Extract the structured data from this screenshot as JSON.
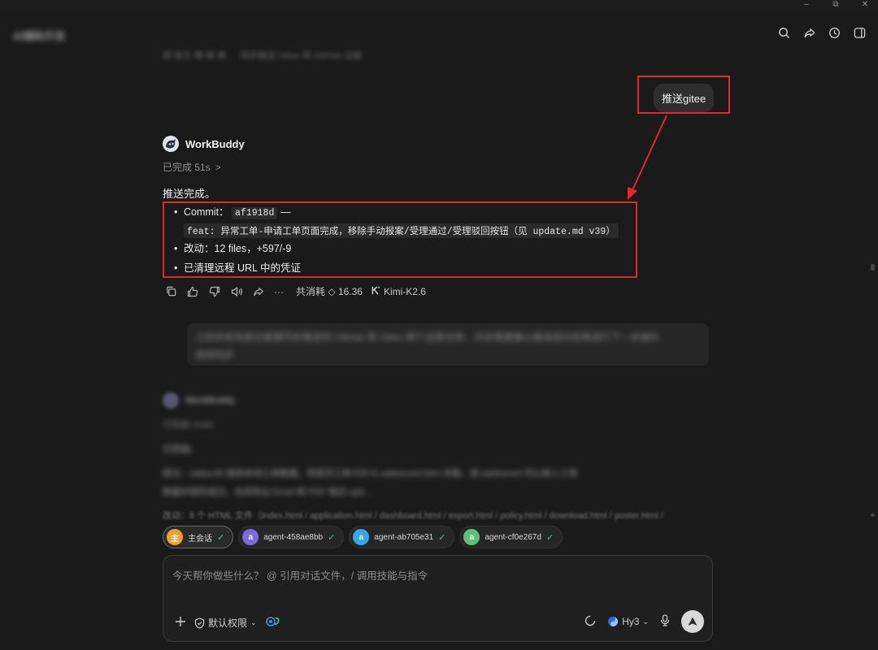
{
  "window": {
    "minimize": "–",
    "maximize": "⧉",
    "close": "✕"
  },
  "header": {
    "chat_title": "AI辅助开发"
  },
  "prev_message": {
    "text": "提 提交 推 推 推 、 同步推送 Gitee 和 GitHub 远程"
  },
  "user_message": {
    "text": "推送gitee"
  },
  "assistant": {
    "name": "WorkBuddy",
    "status": "已完成 51s",
    "status_chevron": ">",
    "summary": "推送完成。",
    "bullets": {
      "commit_label": "Commit：",
      "commit_hash": "af1918d",
      "commit_dash": "—",
      "commit_message": "feat: 异常工单-申请工单页面完成，移除手动报案/受理通过/受理驳回按钮（见 update.md v39）",
      "changes": "改动：12 files，+597/-9",
      "cleanup": "已清理远程 URL 中的凭证"
    },
    "actions": {
      "cost": "共消耗 ◇ 16.36",
      "model": "Kimi-K2.6",
      "more": "···"
    }
  },
  "blurred": {
    "user_msg_line1": "之后的修改提交都要同步推送到 GitHub 和 Gitee 两个远程仓库，并且需要确认推送成功后再进行下一步操作",
    "user_msg_line2": "保持同步",
    "agent_name": "WorkBuddy",
    "agent_status": "已完成 1m6s",
    "summary": "已完成。",
    "line1": "提交：0a8ec35 使用本地工单数据，将首页工单卡片与 addrecord.html 关联，使 addrecord 可以录入工单",
    "line2": "数据并保存成功，支持导出 Excel 和 PDF 格式 upd…",
    "changes": "改动：8 个 HTML 文件（index.html / application.html / dashboard.html / export.html / policy.html / download.html / poster.html /"
  },
  "agents": [
    {
      "avatar": "主",
      "label": "主会话",
      "color": "#f0a030"
    },
    {
      "avatar": "a",
      "label": "agent-458ae8bb",
      "color": "#7b6ae0"
    },
    {
      "avatar": "a",
      "label": "agent-ab705e31",
      "color": "#38a7e8"
    },
    {
      "avatar": "a",
      "label": "agent-cf0e267d",
      "color": "#5cbf7a"
    }
  ],
  "input": {
    "placeholder": "今天帮你做些什么？ @ 引用对话文件，/ 调用技能与指令",
    "permission": "默认权限",
    "model": "Hy3"
  }
}
